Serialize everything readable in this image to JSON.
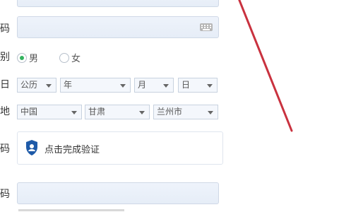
{
  "form": {
    "password_label": "码",
    "gender_label": "别",
    "gender_options": [
      "男",
      "女"
    ],
    "birthday_label": "日",
    "birthday": {
      "calendar": "公历",
      "year": "年",
      "month": "月",
      "day": "日"
    },
    "location_label": "地",
    "location": {
      "country": "中国",
      "province": "甘肃",
      "city": "兰州市"
    },
    "verify_label": "码",
    "verify_button_text": "点击完成验证",
    "sms_label": "码"
  },
  "colors": {
    "accent": "#33b35f",
    "annotation": "#c9323f",
    "shield": "#1e5aa8"
  },
  "icons": {
    "keyboard": "keyboard-icon",
    "shield": "shield-icon"
  }
}
